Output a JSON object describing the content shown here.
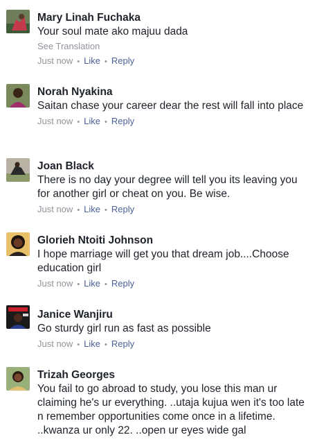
{
  "comments": [
    {
      "name": "Mary Linah Fuchaka",
      "text": "Your soul mate ako majuu dada",
      "see_translation": "See Translation",
      "time": "Just now",
      "like": "Like",
      "reply": "Reply"
    },
    {
      "name": "Norah Nyakina",
      "text": "Saitan chase your career dear the rest will fall into place",
      "time": "Just now",
      "like": "Like",
      "reply": "Reply"
    },
    {
      "name": "Joan Black",
      "text": "There is no day your degree will tell you its leaving you for another girl or cheat on you. Be wise.",
      "time": "Just now",
      "like": "Like",
      "reply": "Reply"
    },
    {
      "name": "Glorieh Ntoiti Johnson",
      "text": "I hope marriage will get you that dream job....Choose education girl",
      "time": "Just now",
      "like": "Like",
      "reply": "Reply"
    },
    {
      "name": "Janice Wanjiru",
      "text": "Go sturdy girl run as fast as possible",
      "time": "Just now",
      "like": "Like",
      "reply": "Reply"
    },
    {
      "name": "Trizah Georges",
      "text": "You fail to go abroad to study, you lose this man ur claiming he's ur everything. ..utaja kujua wen it's too late n remember opportunities come once in a lifetime. ..kwanza ur only 22. ..open ur eyes wide gal"
    }
  ]
}
